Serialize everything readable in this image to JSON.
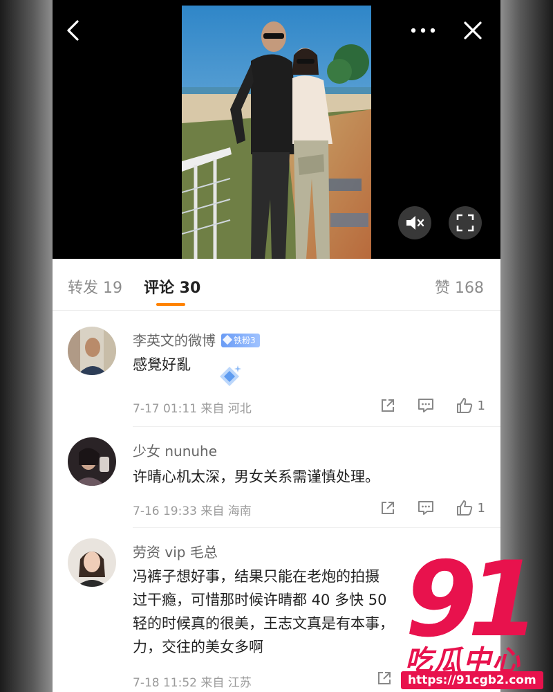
{
  "video": {
    "back_icon": "chevron-left-icon",
    "more_icon": "more-dots-icon",
    "close_icon": "close-icon",
    "mute_icon": "speaker-muted-icon",
    "fullscreen_icon": "fullscreen-icon"
  },
  "tabs": [
    {
      "label": "转发 19"
    },
    {
      "label": "评论 30"
    },
    {
      "label": "赞 168"
    }
  ],
  "accent_color": "#ff8200",
  "comments": [
    {
      "name": "李英文的微博",
      "badge": "铁粉3",
      "text": "感覺好亂",
      "meta": "7-17 01:11  来自 河北",
      "likes": "1"
    },
    {
      "name": "少女 nunuhe",
      "text": "许晴心机太深，男女关系需谨慎处理。",
      "meta": "7-16 19:33  来自 海南",
      "likes": "1"
    },
    {
      "name": "劳资 vip 毛总",
      "text": "冯裤子想好事，结果只能在老炮的拍摄",
      "text2": "过干瘾，可惜那时候许晴都 40 多快 50",
      "text3": "轻的时候真的很美，王志文真是有本事，",
      "text4": "力，交往的美女多啊",
      "meta": "7-18 11:52  来自 江苏"
    }
  ],
  "watermark": {
    "number": "91",
    "name": "吃瓜中心",
    "url": "https://91cgb2.com"
  }
}
